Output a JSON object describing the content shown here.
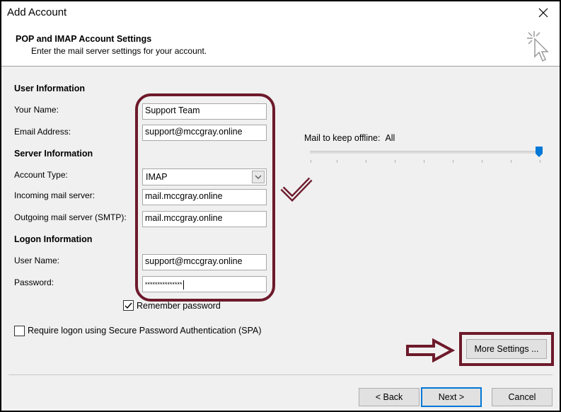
{
  "window": {
    "title": "Add Account"
  },
  "header": {
    "title": "POP and IMAP Account Settings",
    "subtitle": "Enter the mail server settings for your account."
  },
  "user_info": {
    "heading": "User Information",
    "name_label": "Your Name:",
    "name_value": "Support Team",
    "email_label": "Email Address:",
    "email_value": "support@mccgray.online"
  },
  "server_info": {
    "heading": "Server Information",
    "account_type_label": "Account Type:",
    "account_type_value": "IMAP",
    "incoming_label": "Incoming mail server:",
    "incoming_value": "mail.mccgray.online",
    "outgoing_label": "Outgoing mail server (SMTP):",
    "outgoing_value": "mail.mccgray.online"
  },
  "logon_info": {
    "heading": "Logon Information",
    "username_label": "User Name:",
    "username_value": "support@mccgray.online",
    "password_label": "Password:",
    "password_value": "***************"
  },
  "remember_password": {
    "label": "Remember password",
    "checked": true
  },
  "spa": {
    "label": "Require logon using Secure Password Authentication (SPA)",
    "checked": false
  },
  "offline": {
    "label": "Mail to keep offline:",
    "value": "All",
    "level": 1.0
  },
  "buttons": {
    "more_settings": "More Settings ...",
    "back": "< Back",
    "next": "Next >",
    "cancel": "Cancel"
  },
  "colors": {
    "annotation": "#6d1a2b",
    "accent": "#0078d7",
    "slider_thumb": "#0078d7"
  },
  "icons": [
    "close-icon",
    "cursor-click-icon",
    "chevron-down-icon",
    "checkmark-annotation-icon",
    "arrow-right-annotation-icon"
  ]
}
